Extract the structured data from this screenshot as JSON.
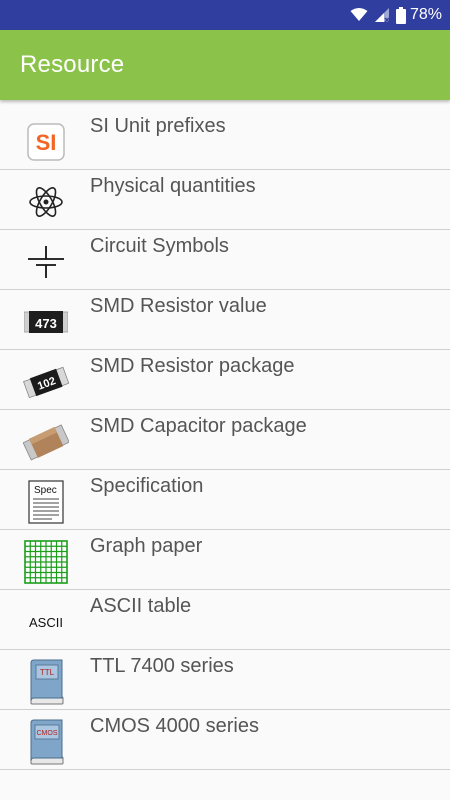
{
  "status_bar": {
    "battery_percent": "78%",
    "icons": [
      "wifi-icon",
      "signal-icon",
      "battery-icon"
    ]
  },
  "app_bar": {
    "title": "Resource",
    "color": "#8bc34a"
  },
  "list": {
    "items": [
      {
        "label": "SI Unit prefixes",
        "icon": "si-unit-icon"
      },
      {
        "label": "Physical quantities",
        "icon": "atom-icon"
      },
      {
        "label": "Circuit Symbols",
        "icon": "capacitor-symbol-icon"
      },
      {
        "label": "SMD Resistor value",
        "icon": "smd-resistor-473-icon",
        "icon_text": "473"
      },
      {
        "label": "SMD Resistor package",
        "icon": "smd-resistor-102-icon",
        "icon_text": "102"
      },
      {
        "label": "SMD Capacitor package",
        "icon": "smd-capacitor-icon"
      },
      {
        "label": "Specification",
        "icon": "spec-document-icon",
        "icon_text": "Spec"
      },
      {
        "label": "Graph paper",
        "icon": "graph-paper-icon"
      },
      {
        "label": "ASCII table",
        "icon": "ascii-icon",
        "icon_text": "ASCII"
      },
      {
        "label": "TTL 7400 series",
        "icon": "ttl-book-icon",
        "icon_text": "TTL"
      },
      {
        "label": "CMOS 4000 series",
        "icon": "cmos-book-icon",
        "icon_text": "CMOS"
      }
    ]
  }
}
